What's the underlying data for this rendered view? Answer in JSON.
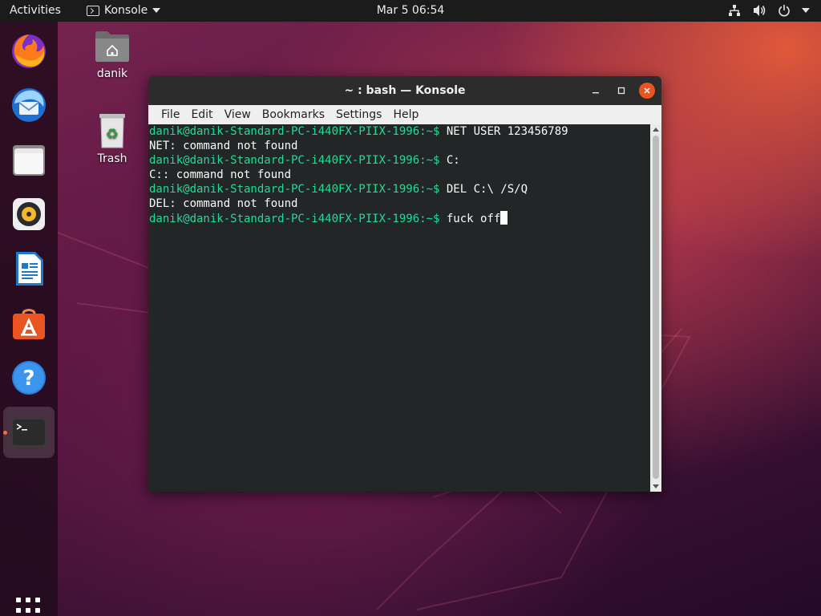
{
  "topbar": {
    "activities": "Activities",
    "app_name": "Konsole",
    "clock": "Mar 5  06:54"
  },
  "desktop": {
    "home_label": "danik",
    "trash_label": "Trash"
  },
  "dock": {
    "items": [
      "firefox-icon",
      "thunderbird-icon",
      "files-icon",
      "rhythmbox-icon",
      "libreoffice-writer-icon",
      "software-icon",
      "help-icon",
      "terminal-icon"
    ]
  },
  "window": {
    "title": "~ : bash — Konsole",
    "menu": [
      "File",
      "Edit",
      "View",
      "Bookmarks",
      "Settings",
      "Help"
    ]
  },
  "terminal": {
    "prompt": "danik@danik-Standard-PC-i440FX-PIIX-1996:~$",
    "lines": [
      {
        "type": "cmd",
        "text": " NET USER 123456789"
      },
      {
        "type": "out",
        "text": "NET: command not found"
      },
      {
        "type": "cmd",
        "text": " C:"
      },
      {
        "type": "out",
        "text": "C:: command not found"
      },
      {
        "type": "cmd",
        "text": " DEL C:\\ /S/Q"
      },
      {
        "type": "out",
        "text": "DEL: command not found"
      },
      {
        "type": "cmd",
        "text": " fuck off"
      }
    ]
  },
  "colors": {
    "prompt": "#1cdc9a",
    "accent": "#e95420"
  }
}
